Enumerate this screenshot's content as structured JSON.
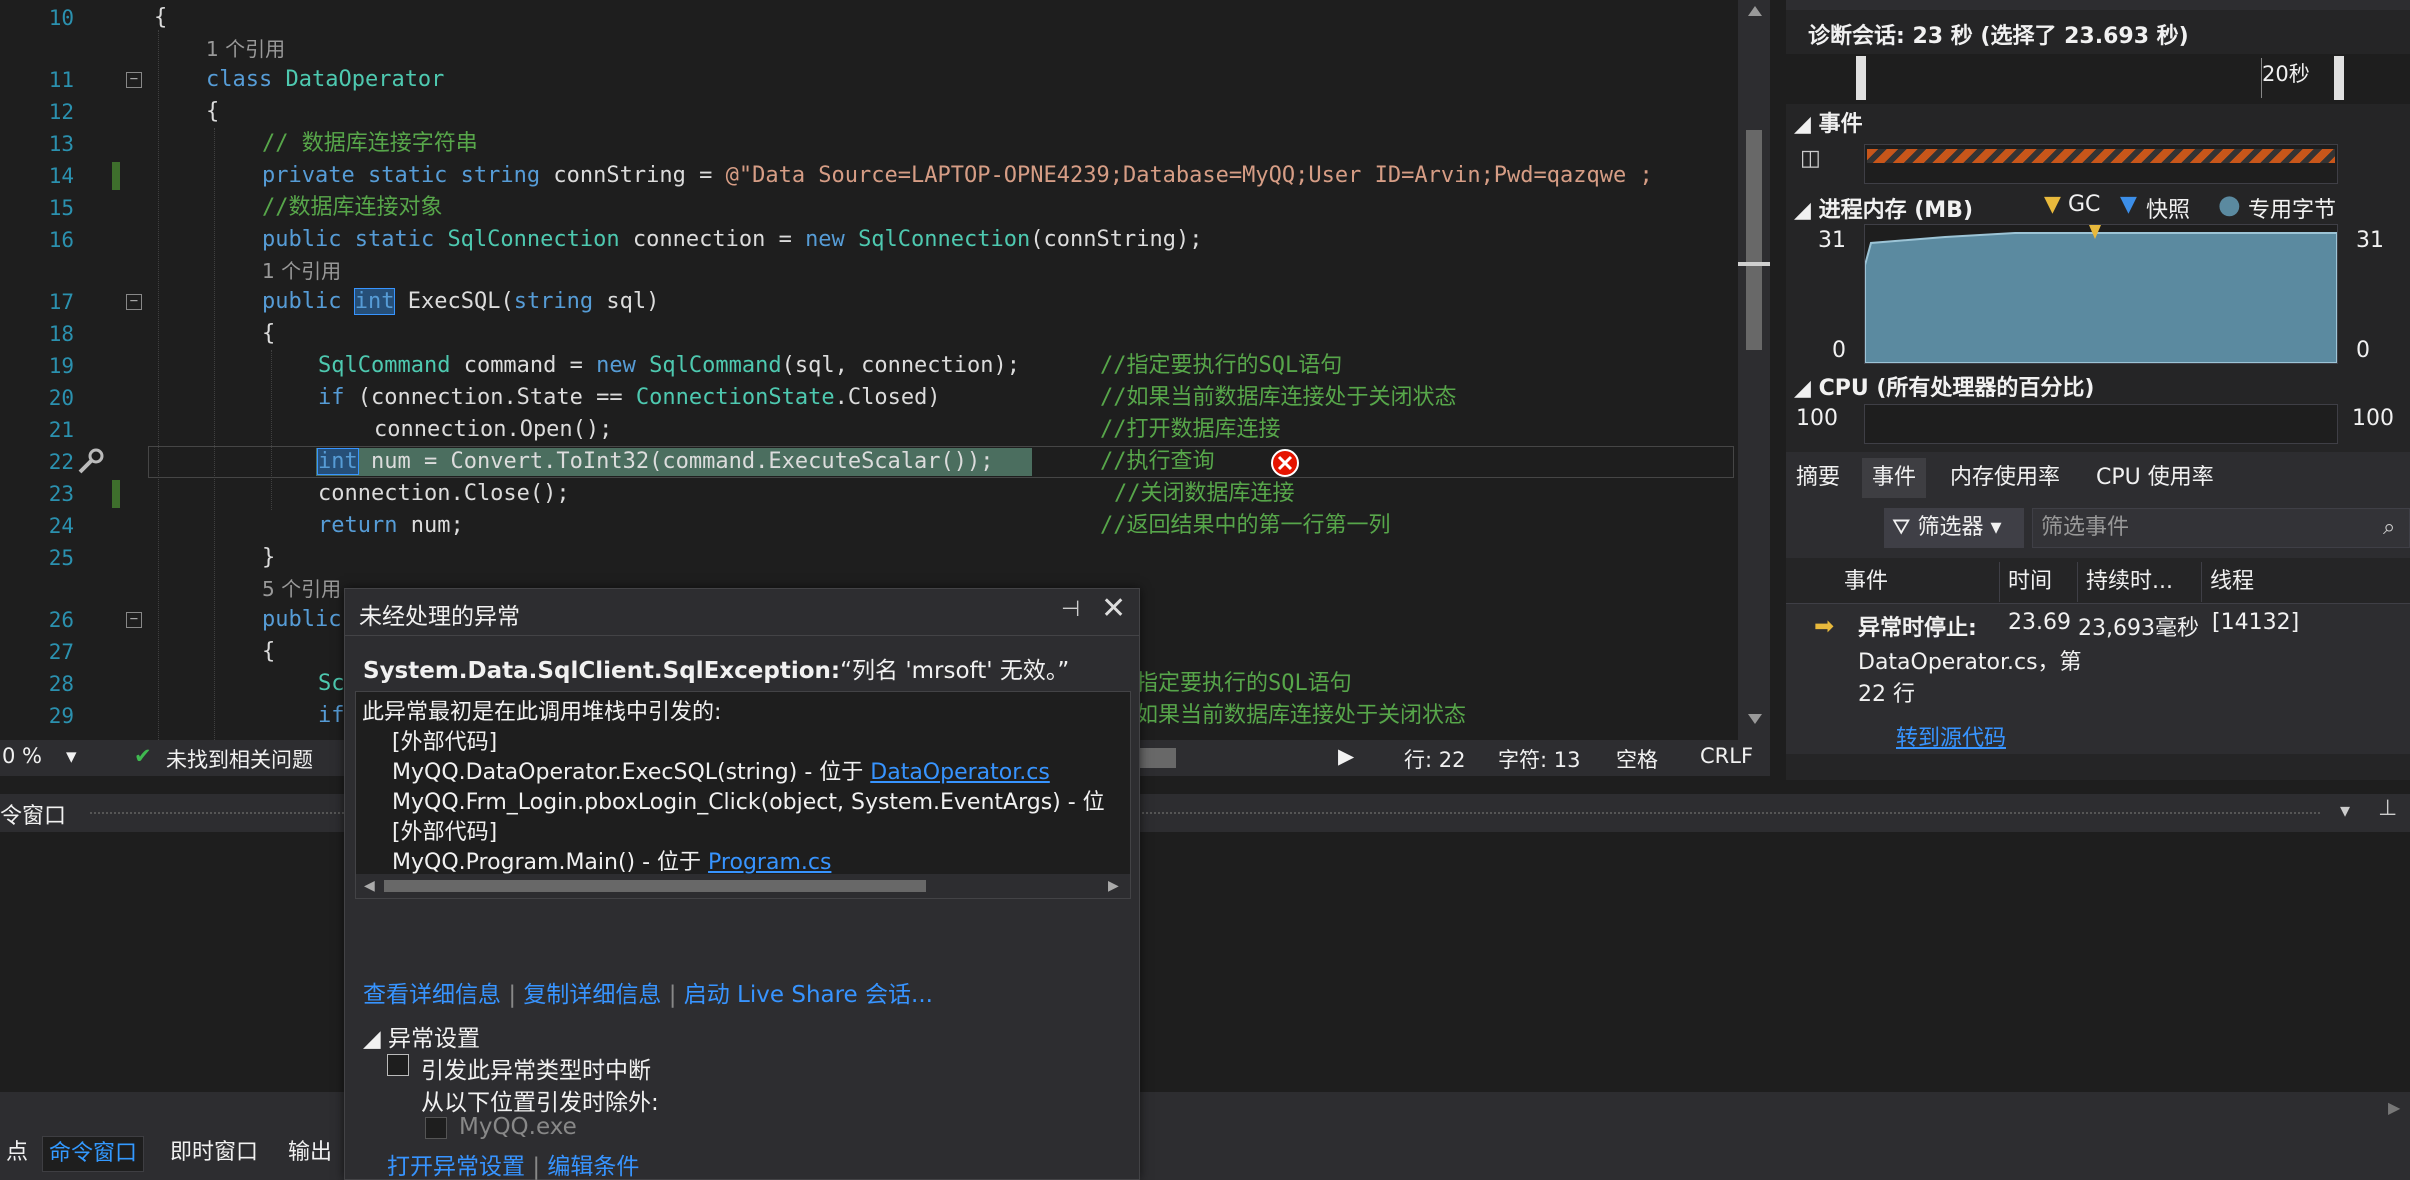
{
  "editor": {
    "line_numbers": [
      "10",
      "11",
      "12",
      "13",
      "14",
      "15",
      "16",
      "17",
      "18",
      "19",
      "20",
      "21",
      "22",
      "23",
      "24",
      "25",
      "26",
      "27",
      "28",
      "29"
    ],
    "ref_labels": {
      "one_ref": "1 个引用",
      "five_ref": "5 个引用"
    },
    "lines": {
      "l10": "{",
      "l11_kw": "class",
      "l11_name": "DataOperator",
      "l12": "{",
      "l13": "// 数据库连接字符串",
      "l14_kw": "private static string",
      "l14_name": " connString = ",
      "l14_str": "@\"Data Source=LAPTOP-OPNE4239;Database=MyQQ;User ID=Arvin;Pwd=qazqwe ;",
      "l15": "//数据库连接对象",
      "l16_kw1": "public static",
      "l16_ty1": "SqlConnection",
      "l16_mid": " connection = ",
      "l16_kw2": "new",
      "l16_ty2": "SqlConnection",
      "l16_end": "(connString);",
      "l17_kw": "public",
      "l17_int": "int",
      "l17_rest": " ExecSQL(",
      "l17_kw2": "string",
      "l17_end": " sql)",
      "l18": "{",
      "l19_ty": "SqlCommand",
      "l19_mid": " command = ",
      "l19_kw": "new",
      "l19_ty2": "SqlCommand",
      "l19_end": "(sql, connection);",
      "l19_cm": "//指定要执行的SQL语句",
      "l20_kw": "if",
      "l20_mid": " (connection.State == ",
      "l20_ty": "ConnectionState",
      "l20_end": ".Closed)",
      "l20_cm": "//如果当前数据库连接处于关闭状态",
      "l21": "connection.Open();",
      "l21_cm": "//打开数据库连接",
      "l22_kw": "int",
      "l22_rest": " num = Convert.ToInt32(command.ExecuteScalar());",
      "l22_cm": "//执行查询",
      "l23": "connection.Close();",
      "l23_cm": "//关闭数据库连接",
      "l24_kw": "return",
      "l24_rest": " num;",
      "l24_cm": "//返回结果中的第一行第一列",
      "l25": "}",
      "l26_kw": "public",
      "l27": "{",
      "l28_frag": "Sc",
      "l28_cm": "指定要执行的SQL语句",
      "l29_frag": "if",
      "l29_cm": "如果当前数据库连接处于关闭状态"
    }
  },
  "status_bar": {
    "zoom": "0 %",
    "issues": "未找到相关问题",
    "line": "行: 22",
    "char": "字符: 13",
    "space": "空格",
    "eol": "CRLF"
  },
  "diagnostics": {
    "session": "诊断会话: 23 秒 (选择了 23.693 秒)",
    "time_tick": "20秒",
    "events_header": "事件",
    "memory_header": "进程内存 (MB)",
    "legend": {
      "gc": "GC",
      "snapshot": "快照",
      "private_bytes": "专用字节"
    },
    "memory_max": "31",
    "memory_min": "0",
    "cpu_header": "CPU (所有处理器的百分比)",
    "cpu_max": "100",
    "tabs": [
      "摘要",
      "事件",
      "内存使用率",
      "CPU 使用率"
    ],
    "active_tab": "事件",
    "filter_label": "筛选器",
    "filter_placeholder": "筛选事件",
    "columns": [
      "事件",
      "时间",
      "持续时...",
      "线程"
    ],
    "event_row": {
      "title": "异常时停止:",
      "detail_1": "DataOperator.cs，第",
      "detail_2": "22 行",
      "time": "23.69",
      "duration": "23,693毫秒",
      "thread": "[14132]",
      "goto": "转到源代码"
    },
    "colors": {
      "memory_fill": "#5b8aa0",
      "events_bar": "#c8561a",
      "gc_marker": "#e8b93c",
      "snapshot_marker": "#3c8ee8"
    }
  },
  "command_window": {
    "title": "令窗口",
    "tabs": [
      "点",
      "命令窗口",
      "即时窗口",
      "输出"
    ],
    "active_tab": "命令窗口"
  },
  "exception": {
    "title": "未经处理的异常",
    "type": "System.Data.SqlClient.SqlException:",
    "message": "“列名 'mrsoft' 无效。”",
    "stack_header": "此异常最初是在此调用堆栈中引发的:",
    "stack": [
      {
        "text": "[外部代码]",
        "link": ""
      },
      {
        "text": "MyQQ.DataOperator.ExecSQL(string) - 位于 ",
        "link": "DataOperator.cs"
      },
      {
        "text": "MyQQ.Frm_Login.pboxLogin_Click(object, System.EventArgs) - 位",
        "link": ""
      },
      {
        "text": "[外部代码]",
        "link": ""
      },
      {
        "text": "MyQQ.Program.Main() - 位于 ",
        "link": "Program.cs"
      }
    ],
    "links": {
      "details": "查看详细信息",
      "copy": "复制详细信息",
      "liveshare": "启动 Live Share 会话..."
    },
    "settings_header": "异常设置",
    "break_label": "引发此异常类型时中断",
    "except_label": "从以下位置引发时除外:",
    "module": "MyQQ.exe",
    "footer": {
      "open_settings": "打开异常设置",
      "edit_conditions": "编辑条件"
    }
  }
}
